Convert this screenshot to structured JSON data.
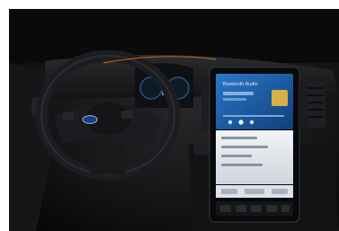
{
  "photo": {
    "subject": "vehicle-interior-dashboard",
    "colors": {
      "cabin_dark": "#0b0b0c",
      "dash_panel": "#18191b",
      "screen_blue": "#1b5fa8",
      "screen_light": "#e6eaef",
      "ford_badge": "#1a3a8a"
    }
  },
  "screen": {
    "title": "Bluetooth Audio"
  }
}
